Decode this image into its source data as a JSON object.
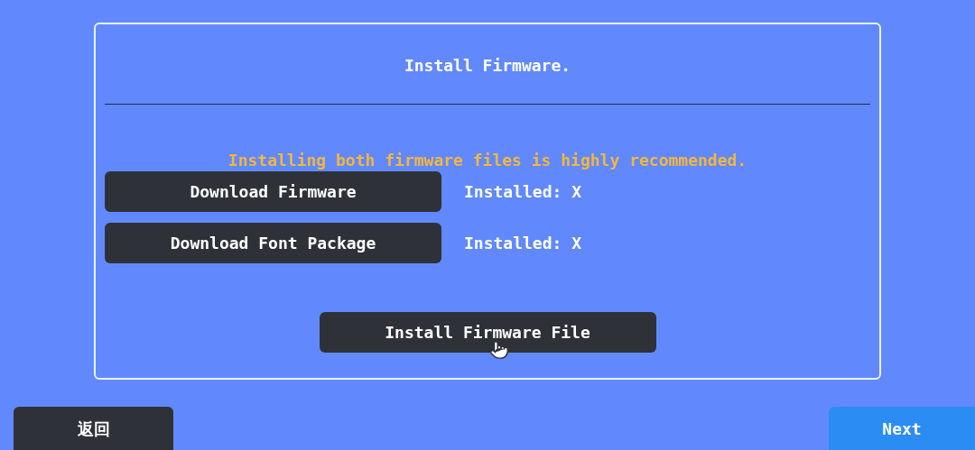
{
  "dialog": {
    "title": "Install Firmware.",
    "notice": "Installing both firmware files is highly recommended.",
    "downloads": [
      {
        "button": "Download Firmware",
        "status": "Installed: X"
      },
      {
        "button": "Download Font Package",
        "status": "Installed: X"
      }
    ],
    "install_button": "Install Firmware File"
  },
  "footer": {
    "back_button": "返回",
    "next_button": "Next"
  }
}
